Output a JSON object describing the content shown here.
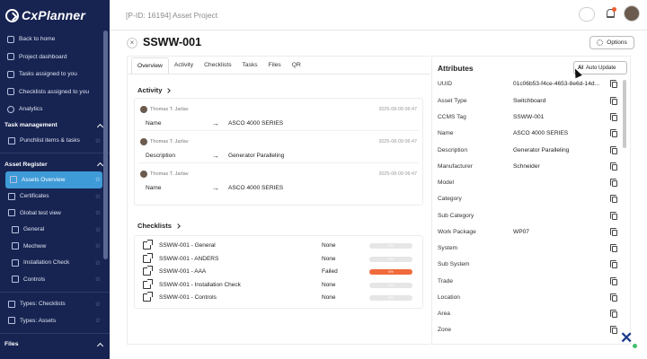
{
  "app": {
    "logo": "CxPlanner"
  },
  "sidebar": {
    "top_items": [
      {
        "label": "Back to home",
        "icon": "back-icon"
      },
      {
        "label": "Project dashboard",
        "icon": "dashboard-icon"
      },
      {
        "label": "Tasks assigned to you",
        "icon": "task-icon"
      },
      {
        "label": "Checklists assigned to you",
        "icon": "checklist-icon"
      },
      {
        "label": "Analytics",
        "icon": "analytics-icon"
      }
    ],
    "task_section": {
      "title": "Task management",
      "items": [
        {
          "label": "Punchlist items & tasks"
        }
      ]
    },
    "asset_section": {
      "title": "Asset Register",
      "items": [
        {
          "label": "Assets Overview"
        },
        {
          "label": "Certificates"
        },
        {
          "label": "Global test view"
        },
        {
          "label": "General"
        },
        {
          "label": "Mechww"
        },
        {
          "label": "Installation Check"
        },
        {
          "label": "Controls"
        },
        {
          "label": "Types: Checklists"
        },
        {
          "label": "Types: Assets"
        }
      ]
    },
    "files_section": {
      "title": "Files"
    }
  },
  "topbar": {
    "project_title": "[P-ID: 16194] Asset Project"
  },
  "asset": {
    "close_glyph": "×",
    "title": "SSWW-001",
    "options_label": "Options"
  },
  "tabs": [
    "Overview",
    "Activity",
    "Checklists",
    "Tasks",
    "Files",
    "QR"
  ],
  "activity": {
    "heading": "Activity",
    "entries": [
      {
        "user": "Thomas T. Jarlav",
        "date": "2025-08-09 06:47",
        "field": "Name",
        "arrow": "→",
        "value": "ASCO 4000 SERIES"
      },
      {
        "user": "Thomas T. Jarlav",
        "date": "2025-08-09 06:47",
        "field": "Description",
        "arrow": "→",
        "value": "Generator Paralleling"
      },
      {
        "user": "Thomas T. Jarlav",
        "date": "2025-08-09 06:47",
        "field": "Name",
        "arrow": "→",
        "value": "ASCO 4000 SERIES"
      }
    ]
  },
  "checklists": {
    "heading": "Checklists",
    "rows": [
      {
        "name": "SSWW-001 - General",
        "status": "None",
        "progress": 0,
        "bar_label": "0%"
      },
      {
        "name": "SSWW-001 - ANDERS",
        "status": "None",
        "progress": 0,
        "bar_label": "0%"
      },
      {
        "name": "SSWW-001 - AAA",
        "status": "Failed",
        "progress": 0,
        "bar_label": "0%"
      },
      {
        "name": "SSWW-001 - Installation Check",
        "status": "None",
        "progress": 0,
        "bar_label": "0%"
      },
      {
        "name": "SSWW-001 - Controls",
        "status": "None",
        "progress": 0,
        "bar_label": "0%"
      }
    ]
  },
  "attributes": {
    "title": "Attributes",
    "auto_update_label": "Auto Update",
    "ai_label": "AI",
    "rows": [
      {
        "label": "UUID",
        "value": "01c06b53-f4ce-4653-8e6d-14d..."
      },
      {
        "label": "Asset Type",
        "value": "Switchboard"
      },
      {
        "label": "CCMS Tag",
        "value": "SSWW-001"
      },
      {
        "label": "Name",
        "value": "ASCO 4000 SERIES"
      },
      {
        "label": "Description",
        "value": "Generator Paralleling"
      },
      {
        "label": "Manufacturer",
        "value": "Schneider"
      },
      {
        "label": "Model",
        "value": ""
      },
      {
        "label": "Category",
        "value": ""
      },
      {
        "label": "Sub Category",
        "value": ""
      },
      {
        "label": "Work Package",
        "value": "WP07"
      },
      {
        "label": "System",
        "value": ""
      },
      {
        "label": "Sub System",
        "value": ""
      },
      {
        "label": "Trade",
        "value": ""
      },
      {
        "label": "Location",
        "value": ""
      },
      {
        "label": "Area",
        "value": ""
      },
      {
        "label": "Zone",
        "value": ""
      }
    ]
  },
  "colors": {
    "sidebar_bg": "#172452",
    "active_item": "#3f9bd8",
    "failed": "#f06a3b",
    "notification": "#f05a2b"
  }
}
